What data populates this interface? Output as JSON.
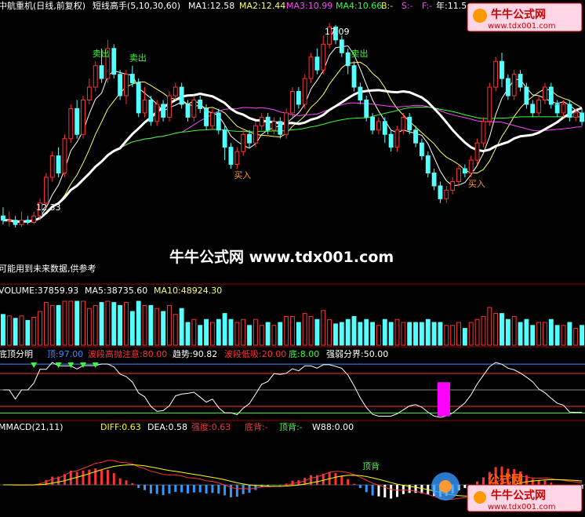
{
  "colors": {
    "up": "#ff3333",
    "down": "#54ffff",
    "ma1": "#ffffff",
    "ma2": "#ffff66",
    "ma3": "#ff44ff",
    "ma4": "#33ff33",
    "grid": "#990000",
    "label_white": "#ffffff",
    "label_yellow": "#ffff00",
    "label_green": "#33ff33",
    "label_magenta": "#ff44ff",
    "label_red": "#ff3333",
    "label_blue": "#4488ff"
  },
  "main_panel": {
    "title": "中航重机(日线,前复权)",
    "indicator_name": "短线高手(5,10,30,60)",
    "ma1": "MA1:12.58",
    "ma2": "MA2:12.44",
    "ma3": "MA3:10.99",
    "ma4": "MA4:10.66",
    "b_label": "B:-",
    "s_label": "S:-",
    "f_label": "F:-",
    "extra": "年:11.5",
    "watermark": "牛牛公式网 www.tdx001.com",
    "disclaimer": "可能用到未来数据,供参考",
    "high_label": "17.09",
    "low_label": "12.33",
    "signals": [
      {
        "text": "卖出",
        "index": 15
      },
      {
        "text": "卖出",
        "index": 21
      },
      {
        "text": "买入",
        "index": 38
      },
      {
        "text": "买入",
        "index": 76
      },
      {
        "text": "卖出",
        "index": 57
      }
    ]
  },
  "volume_panel": {
    "volume": "VOLUME:37859.93",
    "ma5": "MA5:38735.60",
    "ma10": "MA10:48924.30"
  },
  "bottom_panel": {
    "name": "底顶分明",
    "top": "顶:97.00",
    "band_high": "波段高抛注意:80.00",
    "trend": "趋势:90.82",
    "band_low": "波段低吸:20.00",
    "bottom": "底:8.00",
    "divide": "强弱分界:50.00"
  },
  "macd_panel": {
    "name": "MMACD(21,11)",
    "diff": "DIFF:0.63",
    "dea": "DEA:0.58",
    "strength": "强度:0.63",
    "bottom_div": "底背:-",
    "top_div": "顶背:-",
    "w88": "W88:0.00",
    "annotation": "顶背"
  },
  "logo_top": {
    "brand": "牛牛公式网",
    "url": "www.tdx001.com"
  },
  "logo_bottom": {
    "brand": "牛牛公式网",
    "url": "www.tdx001.com",
    "side": "公式网"
  },
  "chart_data": {
    "type": "candlestick",
    "price_range": [
      11.6,
      17.3
    ],
    "candles": [
      [
        12.6,
        12.5,
        12.8,
        12.4
      ],
      [
        12.5,
        12.5,
        12.7,
        12.35
      ],
      [
        12.5,
        12.4,
        12.6,
        12.33
      ],
      [
        12.4,
        12.5,
        12.7,
        12.35
      ],
      [
        12.5,
        12.45,
        12.6,
        12.4
      ],
      [
        12.45,
        12.6,
        12.7,
        12.4
      ],
      [
        12.6,
        12.9,
        13.0,
        12.5
      ],
      [
        12.9,
        13.5,
        13.6,
        12.8
      ],
      [
        13.5,
        14.0,
        14.1,
        13.4
      ],
      [
        14.0,
        13.6,
        14.2,
        13.5
      ],
      [
        13.6,
        14.4,
        14.5,
        13.5
      ],
      [
        14.4,
        15.1,
        15.2,
        14.3
      ],
      [
        15.1,
        14.5,
        15.3,
        14.4
      ],
      [
        14.5,
        15.3,
        15.4,
        14.4
      ],
      [
        15.3,
        15.6,
        15.8,
        15.2
      ],
      [
        15.6,
        16.1,
        16.2,
        15.5
      ],
      [
        16.1,
        15.8,
        16.5,
        15.7
      ],
      [
        15.8,
        16.5,
        16.7,
        15.7
      ],
      [
        16.5,
        15.9,
        16.6,
        15.8
      ],
      [
        15.9,
        15.4,
        16.0,
        15.3
      ],
      [
        15.4,
        15.9,
        16.0,
        15.2
      ],
      [
        15.9,
        15.7,
        16.1,
        15.6
      ],
      [
        15.7,
        15.0,
        15.8,
        14.9
      ],
      [
        15.0,
        15.3,
        15.6,
        14.9
      ],
      [
        15.3,
        14.8,
        15.4,
        14.7
      ],
      [
        14.8,
        15.2,
        15.3,
        14.7
      ],
      [
        15.2,
        14.9,
        15.3,
        14.8
      ],
      [
        14.9,
        15.4,
        15.5,
        14.8
      ],
      [
        15.4,
        15.6,
        15.7,
        15.3
      ],
      [
        15.6,
        15.2,
        15.7,
        15.1
      ],
      [
        15.2,
        14.9,
        15.3,
        14.8
      ],
      [
        14.9,
        15.3,
        15.4,
        14.8
      ],
      [
        15.3,
        15.1,
        15.4,
        15.0
      ],
      [
        15.1,
        14.7,
        15.2,
        14.6
      ],
      [
        14.7,
        15.0,
        15.1,
        14.6
      ],
      [
        15.0,
        14.6,
        15.1,
        14.5
      ],
      [
        14.6,
        14.2,
        14.7,
        13.9
      ],
      [
        14.2,
        13.8,
        14.3,
        13.7
      ],
      [
        13.8,
        14.1,
        14.2,
        13.7
      ],
      [
        14.1,
        14.5,
        14.6,
        14.0
      ],
      [
        14.5,
        14.3,
        14.6,
        14.2
      ],
      [
        14.3,
        14.7,
        14.8,
        14.2
      ],
      [
        14.7,
        14.9,
        15.0,
        14.6
      ],
      [
        14.9,
        14.6,
        15.0,
        14.5
      ],
      [
        14.6,
        14.8,
        14.9,
        14.5
      ],
      [
        14.8,
        14.5,
        14.9,
        14.4
      ],
      [
        14.5,
        15.0,
        15.1,
        14.4
      ],
      [
        15.0,
        15.5,
        15.6,
        14.9
      ],
      [
        15.5,
        15.2,
        15.6,
        15.1
      ],
      [
        15.2,
        15.8,
        15.9,
        15.1
      ],
      [
        15.8,
        16.3,
        16.4,
        15.7
      ],
      [
        16.3,
        16.0,
        16.5,
        15.9
      ],
      [
        16.0,
        16.6,
        16.8,
        15.9
      ],
      [
        16.6,
        17.0,
        17.09,
        16.5
      ],
      [
        17.0,
        16.7,
        17.05,
        16.6
      ],
      [
        16.7,
        16.4,
        16.8,
        16.3
      ],
      [
        16.4,
        16.1,
        16.5,
        15.9
      ],
      [
        16.1,
        15.6,
        16.2,
        15.5
      ],
      [
        15.6,
        15.3,
        15.7,
        15.2
      ],
      [
        15.3,
        14.9,
        15.4,
        14.8
      ],
      [
        14.9,
        14.6,
        15.0,
        14.5
      ],
      [
        14.6,
        14.8,
        14.9,
        14.5
      ],
      [
        14.8,
        14.5,
        14.9,
        14.3
      ],
      [
        14.5,
        14.2,
        14.6,
        14.1
      ],
      [
        14.2,
        14.6,
        14.7,
        14.1
      ],
      [
        14.6,
        14.9,
        15.0,
        14.5
      ],
      [
        14.9,
        14.6,
        15.0,
        14.5
      ],
      [
        14.6,
        14.3,
        14.7,
        14.2
      ],
      [
        14.3,
        14.0,
        14.4,
        13.9
      ],
      [
        14.0,
        13.6,
        14.1,
        13.5
      ],
      [
        13.6,
        13.3,
        13.7,
        13.2
      ],
      [
        13.3,
        13.0,
        13.4,
        12.9
      ],
      [
        13.0,
        13.2,
        13.3,
        12.9
      ],
      [
        13.2,
        13.4,
        13.5,
        13.1
      ],
      [
        13.4,
        13.7,
        13.8,
        13.3
      ],
      [
        13.7,
        13.6,
        13.8,
        13.5
      ],
      [
        13.6,
        13.9,
        14.0,
        13.5
      ],
      [
        13.9,
        14.3,
        14.4,
        13.8
      ],
      [
        14.3,
        14.8,
        14.9,
        14.2
      ],
      [
        14.8,
        15.6,
        15.7,
        14.7
      ],
      [
        15.6,
        16.2,
        16.3,
        15.5
      ],
      [
        16.2,
        15.8,
        16.4,
        15.6
      ],
      [
        15.8,
        15.4,
        15.9,
        15.3
      ],
      [
        15.4,
        15.9,
        16.0,
        15.3
      ],
      [
        15.9,
        15.6,
        16.0,
        15.5
      ],
      [
        15.6,
        15.2,
        15.7,
        15.1
      ],
      [
        15.2,
        15.0,
        15.3,
        14.9
      ],
      [
        15.0,
        15.3,
        15.4,
        14.9
      ],
      [
        15.3,
        15.6,
        15.7,
        15.2
      ],
      [
        15.6,
        15.2,
        15.7,
        15.1
      ],
      [
        15.2,
        15.0,
        15.3,
        14.9
      ],
      [
        15.0,
        15.2,
        15.3,
        14.9
      ],
      [
        15.2,
        14.9,
        15.3,
        14.8
      ],
      [
        14.9,
        15.0,
        15.1,
        14.8
      ],
      [
        15.0,
        14.8,
        15.1,
        14.7
      ]
    ]
  }
}
